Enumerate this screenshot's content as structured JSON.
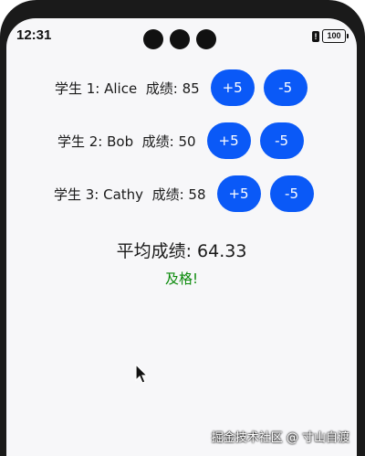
{
  "status_bar": {
    "time": "12:31",
    "alert": "!",
    "battery": "100"
  },
  "students": [
    {
      "label": "学生 1: Alice  成绩: 85",
      "inc": "+5",
      "dec": "-5"
    },
    {
      "label": "学生 2: Bob  成绩: 50",
      "inc": "+5",
      "dec": "-5"
    },
    {
      "label": "学生 3: Cathy  成绩: 58",
      "inc": "+5",
      "dec": "-5"
    }
  ],
  "average": "平均成绩: 64.33",
  "pass_status": "及格!",
  "watermark": "掘金技术社区 @ 寸山自渡",
  "colors": {
    "button": "#0a59f7",
    "pass": "#0b8a0b"
  }
}
